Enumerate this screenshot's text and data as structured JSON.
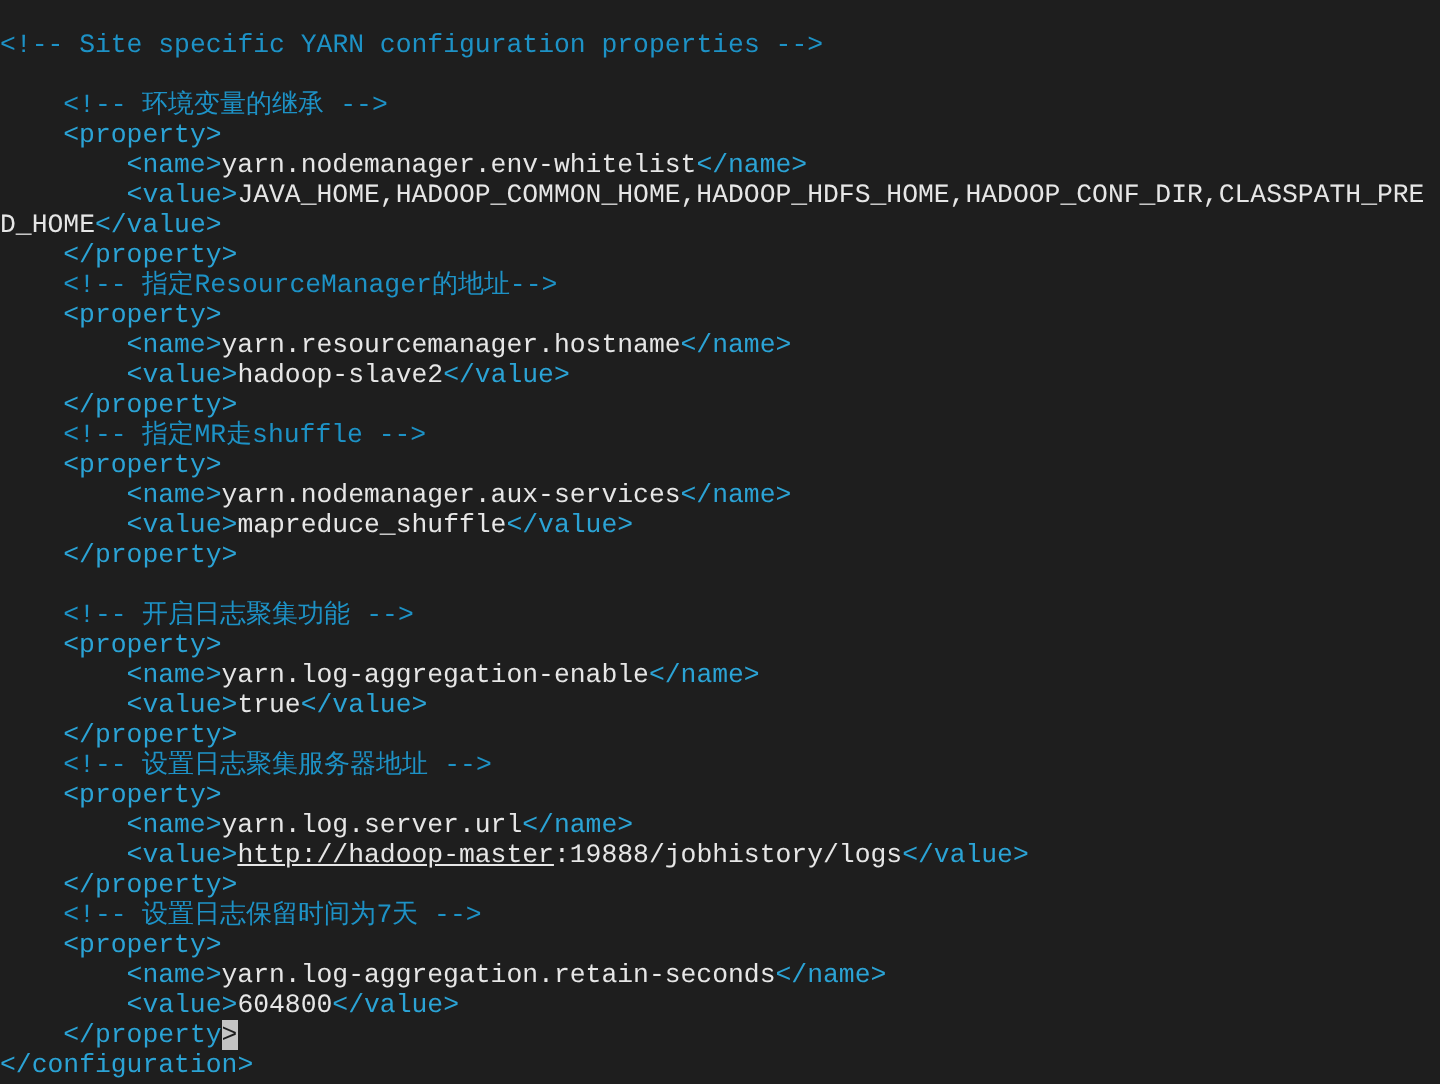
{
  "rows": [
    {
      "kind": "line",
      "segments": [
        {
          "kind": "comment",
          "text": "<!-- Site specific YARN configuration properties -->"
        }
      ]
    },
    {
      "kind": "blank"
    },
    {
      "kind": "group",
      "children": [
        {
          "kind": "line",
          "segments": [
            {
              "kind": "comment",
              "text": "<!-- 环境变量的继承 -->"
            }
          ]
        },
        {
          "kind": "line",
          "segments": [
            {
              "kind": "tag",
              "text": "<property>"
            }
          ]
        },
        {
          "kind": "group",
          "children": [
            {
              "kind": "line",
              "segments": [
                {
                  "kind": "tag",
                  "text": "<name>"
                },
                {
                  "kind": "text",
                  "text": "yarn.nodemanager.env-whitelist"
                },
                {
                  "kind": "tag",
                  "text": "</name>"
                }
              ]
            },
            {
              "kind": "line",
              "segments": [
                {
                  "kind": "tag",
                  "text": "<value>"
                },
                {
                  "kind": "text",
                  "text": "JAVA_HOME,HADOOP_COMMON_HOME,HADOOP_HDFS_HOME,HADOOP_CONF_DIR,CLASSPATH_PRE"
                }
              ]
            }
          ]
        }
      ]
    },
    {
      "kind": "line",
      "segments": [
        {
          "kind": "text",
          "text": "D_HOME"
        },
        {
          "kind": "tag",
          "text": "</value>"
        }
      ]
    },
    {
      "kind": "group",
      "children": [
        {
          "kind": "line",
          "segments": [
            {
              "kind": "tag",
              "text": "</property>"
            }
          ]
        },
        {
          "kind": "line",
          "segments": [
            {
              "kind": "comment",
              "text": "<!-- 指定ResourceManager的地址-->"
            }
          ]
        },
        {
          "kind": "line",
          "segments": [
            {
              "kind": "tag",
              "text": "<property>"
            }
          ]
        },
        {
          "kind": "group",
          "children": [
            {
              "kind": "line",
              "segments": [
                {
                  "kind": "tag",
                  "text": "<name>"
                },
                {
                  "kind": "text",
                  "text": "yarn.resourcemanager.hostname"
                },
                {
                  "kind": "tag",
                  "text": "</name>"
                }
              ]
            },
            {
              "kind": "line",
              "segments": [
                {
                  "kind": "tag",
                  "text": "<value>"
                },
                {
                  "kind": "text",
                  "text": "hadoop-slave2"
                },
                {
                  "kind": "tag",
                  "text": "</value>"
                }
              ]
            }
          ]
        },
        {
          "kind": "line",
          "segments": [
            {
              "kind": "tag",
              "text": "</property>"
            }
          ]
        },
        {
          "kind": "line",
          "segments": [
            {
              "kind": "comment",
              "text": "<!-- 指定MR走shuffle -->"
            }
          ]
        },
        {
          "kind": "line",
          "segments": [
            {
              "kind": "tag",
              "text": "<property>"
            }
          ]
        },
        {
          "kind": "group",
          "children": [
            {
              "kind": "line",
              "segments": [
                {
                  "kind": "tag",
                  "text": "<name>"
                },
                {
                  "kind": "text",
                  "text": "yarn.nodemanager.aux-services"
                },
                {
                  "kind": "tag",
                  "text": "</name>"
                }
              ]
            },
            {
              "kind": "line",
              "segments": [
                {
                  "kind": "tag",
                  "text": "<value>"
                },
                {
                  "kind": "text",
                  "text": "mapreduce_shuffle"
                },
                {
                  "kind": "tag",
                  "text": "</value>"
                }
              ]
            }
          ]
        },
        {
          "kind": "line",
          "segments": [
            {
              "kind": "tag",
              "text": "</property>"
            }
          ]
        },
        {
          "kind": "blank"
        },
        {
          "kind": "line",
          "segments": [
            {
              "kind": "comment",
              "text": "<!-- 开启日志聚集功能 -->"
            }
          ]
        },
        {
          "kind": "line",
          "segments": [
            {
              "kind": "tag",
              "text": "<property>"
            }
          ]
        },
        {
          "kind": "group",
          "children": [
            {
              "kind": "line",
              "segments": [
                {
                  "kind": "tag",
                  "text": "<name>"
                },
                {
                  "kind": "text",
                  "text": "yarn.log-aggregation-enable"
                },
                {
                  "kind": "tag",
                  "text": "</name>"
                }
              ]
            },
            {
              "kind": "line",
              "segments": [
                {
                  "kind": "tag",
                  "text": "<value>"
                },
                {
                  "kind": "text",
                  "text": "true"
                },
                {
                  "kind": "tag",
                  "text": "</value>"
                }
              ]
            }
          ]
        },
        {
          "kind": "line",
          "segments": [
            {
              "kind": "tag",
              "text": "</property>"
            }
          ]
        },
        {
          "kind": "line",
          "segments": [
            {
              "kind": "comment",
              "text": "<!-- 设置日志聚集服务器地址 -->"
            }
          ]
        },
        {
          "kind": "line",
          "segments": [
            {
              "kind": "tag",
              "text": "<property>"
            }
          ]
        },
        {
          "kind": "group",
          "children": [
            {
              "kind": "line",
              "segments": [
                {
                  "kind": "tag",
                  "text": "<name>"
                },
                {
                  "kind": "text",
                  "text": "yarn.log.server.url"
                },
                {
                  "kind": "tag",
                  "text": "</name>"
                }
              ]
            },
            {
              "kind": "line",
              "segments": [
                {
                  "kind": "tag",
                  "text": "<value>"
                },
                {
                  "kind": "link",
                  "text": "http://hadoop-master"
                },
                {
                  "kind": "text",
                  "text": ":19888/jobhistory/logs"
                },
                {
                  "kind": "tag",
                  "text": "</value>"
                }
              ]
            }
          ]
        },
        {
          "kind": "line",
          "segments": [
            {
              "kind": "tag",
              "text": "</property>"
            }
          ]
        },
        {
          "kind": "line",
          "segments": [
            {
              "kind": "comment",
              "text": "<!-- 设置日志保留时间为7天 -->"
            }
          ]
        },
        {
          "kind": "line",
          "segments": [
            {
              "kind": "tag",
              "text": "<property>"
            }
          ]
        },
        {
          "kind": "group",
          "children": [
            {
              "kind": "line",
              "segments": [
                {
                  "kind": "tag",
                  "text": "<name>"
                },
                {
                  "kind": "text",
                  "text": "yarn.log-aggregation.retain-seconds"
                },
                {
                  "kind": "tag",
                  "text": "</name>"
                }
              ]
            },
            {
              "kind": "line",
              "segments": [
                {
                  "kind": "tag",
                  "text": "<value>"
                },
                {
                  "kind": "text",
                  "text": "604800"
                },
                {
                  "kind": "tag",
                  "text": "</value>"
                }
              ]
            }
          ]
        },
        {
          "kind": "line",
          "segments": [
            {
              "kind": "tag",
              "text": "</property"
            },
            {
              "kind": "cursor",
              "text": ">"
            }
          ]
        }
      ]
    },
    {
      "kind": "line",
      "segments": [
        {
          "kind": "tag",
          "text": "</configuration>"
        }
      ]
    }
  ]
}
